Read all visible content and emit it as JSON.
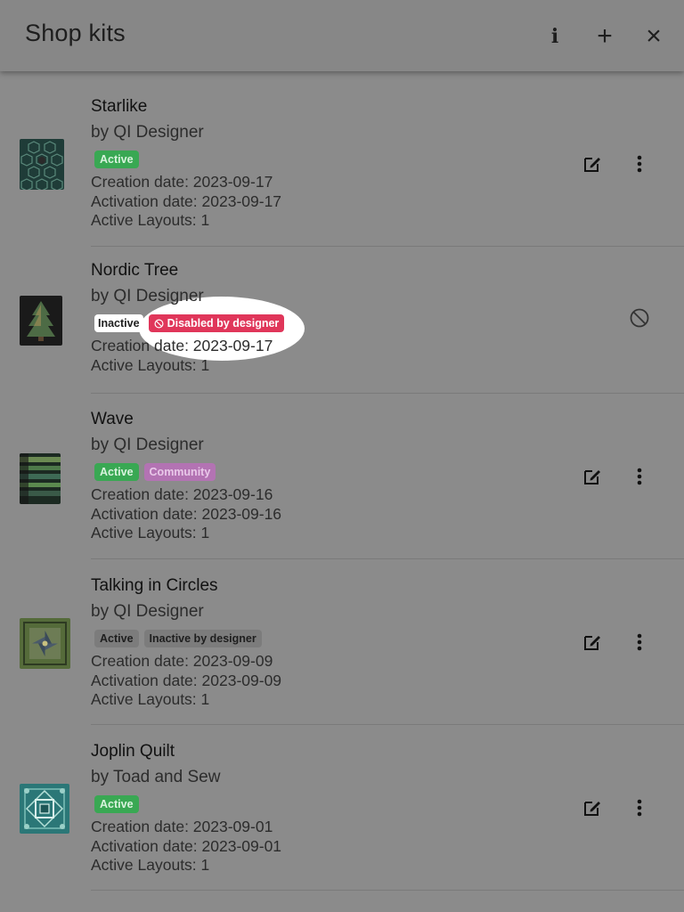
{
  "header": {
    "title": "Shop kits",
    "info_label": "i",
    "add_label": "+",
    "close_label": "×"
  },
  "colors": {
    "active": "#39a853",
    "community": "#b373b3",
    "disabled": "#e0365a",
    "neutral": "#7c7c7c"
  },
  "kits": [
    {
      "name": "Starlike",
      "designer": "by QI Designer",
      "badges": [
        "Active"
      ],
      "creation": "Creation date: 2023-09-17",
      "activation": "Activation date: 2023-09-17",
      "layouts": "Active Layouts: 1"
    },
    {
      "name": "Nordic Tree",
      "designer": "by QI Designer",
      "badges": [
        "Inactive",
        "Disabled by designer"
      ],
      "creation": "Creation date: 2023-09-17",
      "layouts": "Active Layouts: 1"
    },
    {
      "name": "Wave",
      "designer": "by QI Designer",
      "badges": [
        "Active",
        "Community"
      ],
      "creation": "Creation date: 2023-09-16",
      "activation": "Activation date: 2023-09-16",
      "layouts": "Active Layouts: 1"
    },
    {
      "name": "Talking in Circles",
      "designer": "by QI Designer",
      "badges": [
        "Active",
        "Inactive by designer"
      ],
      "creation": "Creation date: 2023-09-09",
      "activation": "Activation date: 2023-09-09",
      "layouts": "Active Layouts: 1"
    },
    {
      "name": "Joplin Quilt",
      "designer": "by Toad and Sew",
      "badges": [
        "Active"
      ],
      "creation": "Creation date: 2023-09-01",
      "activation": "Activation date: 2023-09-01",
      "layouts": "Active Layouts: 1"
    }
  ]
}
